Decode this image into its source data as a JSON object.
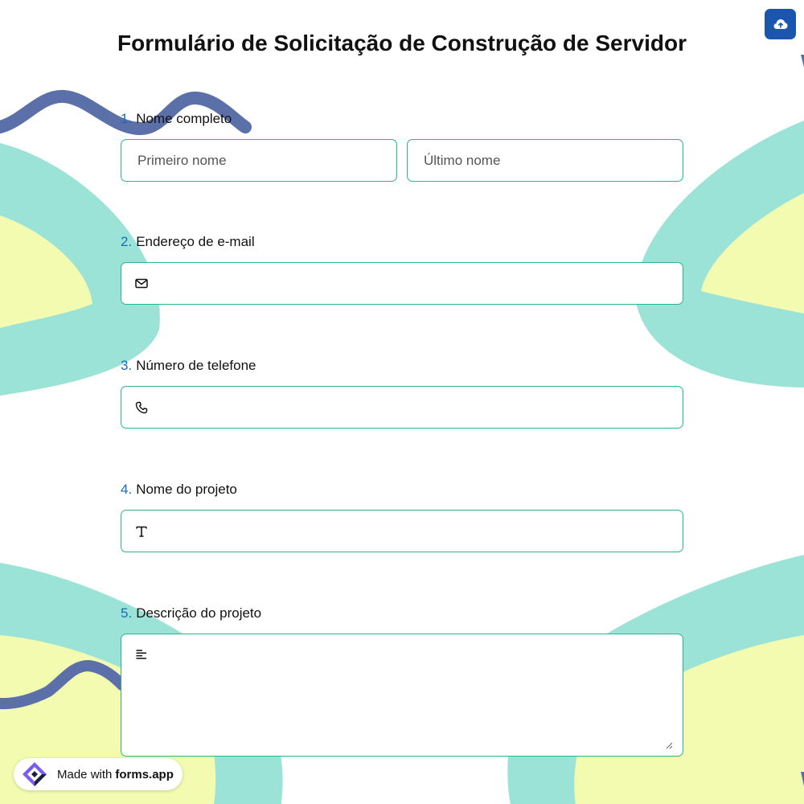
{
  "form": {
    "title": "Formulário de Solicitação de Construção de Servidor"
  },
  "toolbar": {
    "upload_icon": "cloud-upload-icon"
  },
  "colors": {
    "accent": "#1a56b0",
    "field_border": "#2bb58f",
    "number": "#1a6bb8",
    "bg_teal": "#9be3d7",
    "bg_yellow": "#f2fbb0",
    "bg_squiggle": "#5b6fa8"
  },
  "questions": [
    {
      "number": "1.",
      "label": "Nome completo",
      "first_name_placeholder": "Primeiro nome",
      "last_name_placeholder": "Último nome"
    },
    {
      "number": "2.",
      "label": "Endereço de e-mail",
      "icon": "envelope-icon",
      "value": ""
    },
    {
      "number": "3.",
      "label": "Número de telefone",
      "icon": "phone-icon",
      "value": ""
    },
    {
      "number": "4.",
      "label": "Nome do projeto",
      "icon": "text-icon",
      "value": ""
    },
    {
      "number": "5.",
      "label": "Descrição do projeto",
      "icon": "paragraph-icon",
      "value": ""
    }
  ],
  "footer": {
    "made_with": "Made with",
    "brand": "forms.app",
    "logo_icon": "forms-app-logo-icon"
  }
}
